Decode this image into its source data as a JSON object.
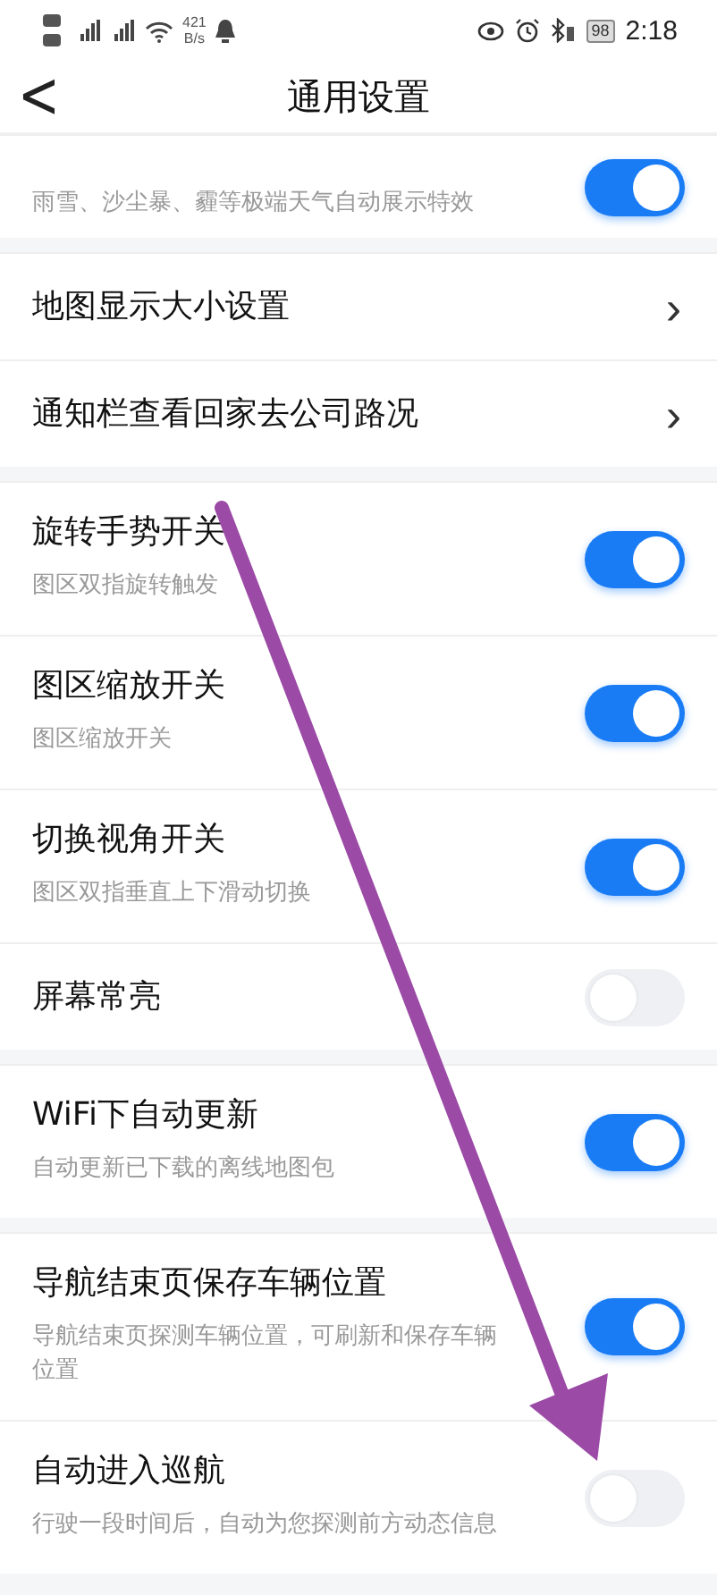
{
  "status_bar": {
    "speed": "421",
    "speed_unit": "B/s",
    "battery": "98",
    "time": "2:18"
  },
  "header": {
    "back": "<",
    "title": "通用设置"
  },
  "groups": [
    {
      "items": [
        {
          "kind": "toggle",
          "subtitle": "雨雪、沙尘暴、霾等极端天气自动展示特效",
          "on": true
        }
      ]
    },
    {
      "items": [
        {
          "kind": "link",
          "title": "地图显示大小设置",
          "chevron": "›"
        },
        {
          "kind": "link",
          "title": "通知栏查看回家去公司路况",
          "chevron": "›"
        }
      ]
    },
    {
      "items": [
        {
          "kind": "toggle",
          "title": "旋转手势开关",
          "subtitle": "图区双指旋转触发",
          "on": true
        },
        {
          "kind": "toggle",
          "title": "图区缩放开关",
          "subtitle": "图区缩放开关",
          "on": true
        },
        {
          "kind": "toggle",
          "title": "切换视角开关",
          "subtitle": "图区双指垂直上下滑动切换",
          "on": true
        },
        {
          "kind": "toggle",
          "title": "屏幕常亮",
          "on": false
        }
      ]
    },
    {
      "items": [
        {
          "kind": "toggle",
          "title": "WiFi下自动更新",
          "subtitle": "自动更新已下载的离线地图包",
          "on": true
        }
      ]
    },
    {
      "items": [
        {
          "kind": "toggle",
          "title": "导航结束页保存车辆位置",
          "subtitle": "导航结束页探测车辆位置，可刷新和保存车辆位置",
          "on": true
        },
        {
          "kind": "toggle",
          "title": "自动进入巡航",
          "subtitle": "行驶一段时间后，自动为您探测前方动态信息",
          "on": false
        }
      ]
    }
  ]
}
